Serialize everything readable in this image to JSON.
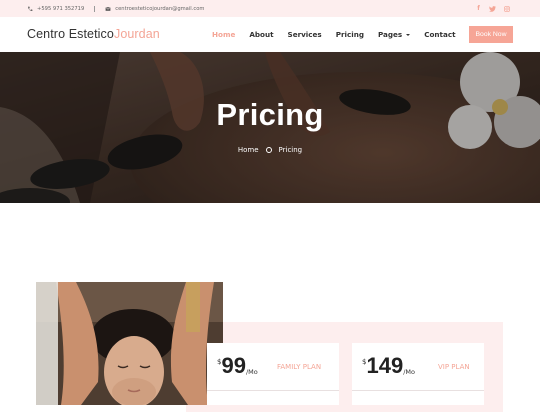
{
  "topbar": {
    "phone": "+595 971 352719",
    "email": "centroesteticojourdan@gmail.com",
    "social": [
      "facebook-icon",
      "twitter-icon",
      "instagram-icon"
    ]
  },
  "brand": {
    "name_main": "Centro Estetico",
    "name_accent": "Jourdan"
  },
  "nav": {
    "items": [
      "Home",
      "About",
      "Services",
      "Pricing",
      "Pages",
      "Contact"
    ],
    "active": "Home",
    "book_label": "Book Now"
  },
  "hero": {
    "title": "Pricing",
    "breadcrumb": [
      "Home",
      "Pricing"
    ]
  },
  "plans": [
    {
      "currency": "$",
      "amount": "99",
      "period": "/Mo",
      "name": "FAMILY PLAN"
    },
    {
      "currency": "$",
      "amount": "149",
      "period": "/Mo",
      "name": "VIP PLAN"
    }
  ],
  "colors": {
    "accent": "#f4a596",
    "topbar_bg": "#fdeeee",
    "button_bg": "#f6a596"
  }
}
